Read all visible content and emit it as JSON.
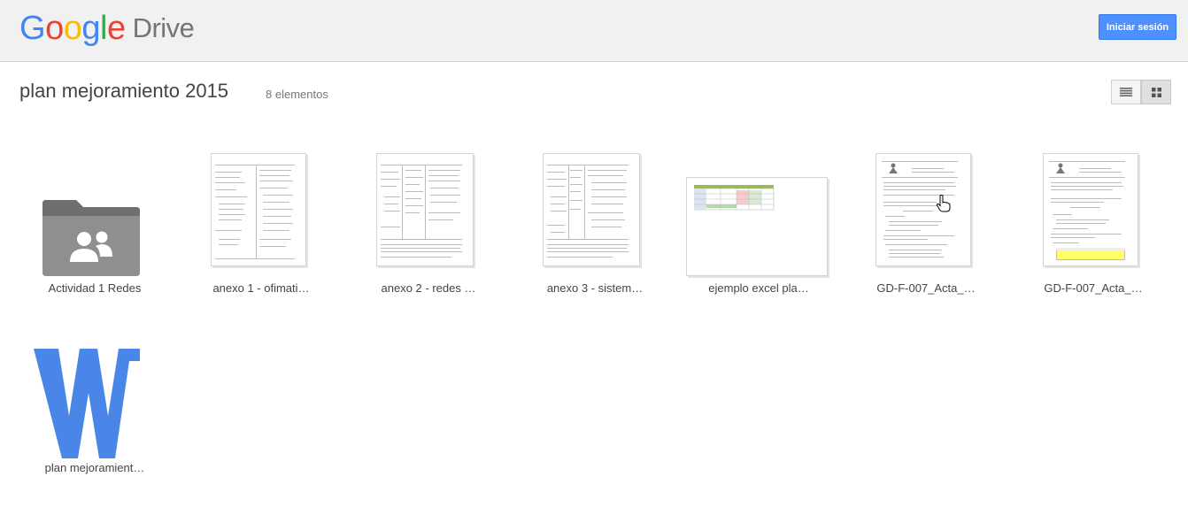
{
  "header": {
    "logo_google": [
      "G",
      "o",
      "o",
      "g",
      "l",
      "e"
    ],
    "logo_drive": "Drive",
    "signin_label": "Iniciar sesión"
  },
  "folder": {
    "title": "plan mejoramiento 2015",
    "count": "8 elementos"
  },
  "view": {
    "list_icon": "list-view-icon",
    "grid_icon": "grid-view-icon",
    "active": "grid"
  },
  "items": [
    {
      "name": "Actividad 1 Redes",
      "type": "shared-folder"
    },
    {
      "name": "anexo 1 - ofimati…",
      "type": "document"
    },
    {
      "name": "anexo 2 - redes …",
      "type": "document"
    },
    {
      "name": "anexo 3 - sistem…",
      "type": "document"
    },
    {
      "name": "ejemplo excel pla…",
      "type": "spreadsheet"
    },
    {
      "name": "GD-F-007_Acta_…",
      "type": "document"
    },
    {
      "name": "GD-F-007_Acta_…",
      "type": "document"
    },
    {
      "name": "plan mejoramient…",
      "type": "word-document"
    }
  ],
  "colors": {
    "accent": "#4d90fe",
    "word": "#4a86e8",
    "folder": "#8f8f8f"
  }
}
